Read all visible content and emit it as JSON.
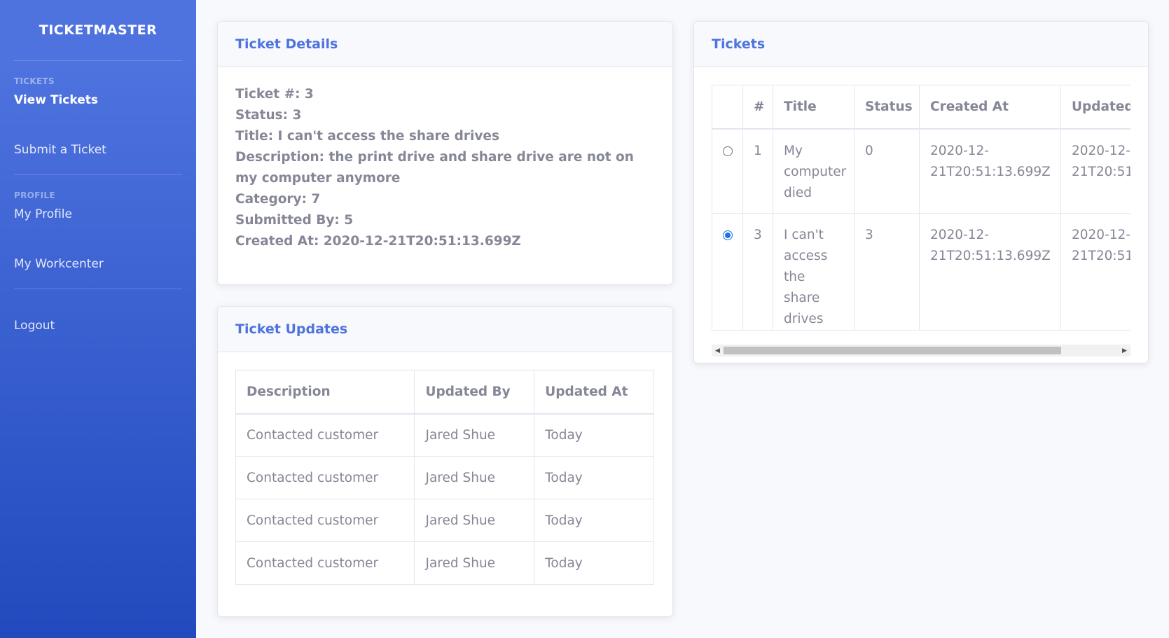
{
  "brand": "TICKETMASTER",
  "sidebar": {
    "tickets_heading": "TICKETS",
    "view_tickets": "View Tickets",
    "submit_ticket": "Submit a Ticket",
    "profile_heading": "PROFILE",
    "my_profile": "My Profile",
    "my_workcenter": "My Workcenter",
    "logout": "Logout"
  },
  "details": {
    "title": "Ticket Details",
    "lines": [
      "Ticket #: 3",
      "Status: 3",
      "Title: I can't access the share drives",
      "Description: the print drive and share drive are not on my computer anymore",
      "Category: 7",
      "Submitted By: 5",
      "Created At: 2020-12-21T20:51:13.699Z"
    ]
  },
  "updates": {
    "title": "Ticket Updates",
    "headers": [
      "Description",
      "Updated By",
      "Updated At"
    ],
    "rows": [
      [
        "Contacted customer",
        "Jared Shue",
        "Today"
      ],
      [
        "Contacted customer",
        "Jared Shue",
        "Today"
      ],
      [
        "Contacted customer",
        "Jared Shue",
        "Today"
      ],
      [
        "Contacted customer",
        "Jared Shue",
        "Today"
      ]
    ]
  },
  "tickets": {
    "title": "Tickets",
    "headers": [
      "",
      "#",
      "Title",
      "Status",
      "Created At",
      "Updated"
    ],
    "rows": [
      {
        "selected": false,
        "id": "1",
        "title": "My computer died",
        "status": "0",
        "created": "2020-12-21T20:51:13.699Z",
        "updated": "2020-12-21T20:51"
      },
      {
        "selected": true,
        "id": "3",
        "title": "I can't access the share drives",
        "status": "3",
        "created": "2020-12-21T20:51:13.699Z",
        "updated": "2020-12-21T20:51"
      }
    ]
  },
  "colors": {
    "accent": "#4e73df",
    "sidebar_bottom": "#224abe",
    "text": "#858796"
  }
}
